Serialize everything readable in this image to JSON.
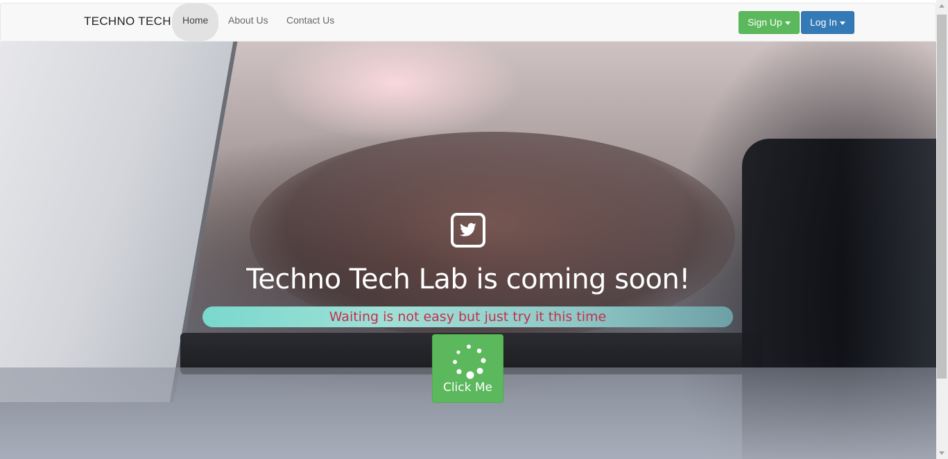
{
  "navbar": {
    "brand": "TECHNO TECH",
    "links": [
      {
        "label": "Home",
        "active": true
      },
      {
        "label": "About Us",
        "active": false
      },
      {
        "label": "Contact Us",
        "active": false
      }
    ],
    "signup_label": "Sign Up",
    "login_label": "Log In"
  },
  "hero": {
    "icon": "twitter-icon",
    "headline": "Techno Tech Lab is coming soon!",
    "tagline": "Waiting is not easy but just try it this time",
    "button_label": "Click Me",
    "button_icon": "spinner-icon"
  },
  "colors": {
    "green": "#5cb85c",
    "blue": "#337ab7",
    "tagline_text": "#c2304f",
    "tagline_bar": "#7ad8cd"
  }
}
